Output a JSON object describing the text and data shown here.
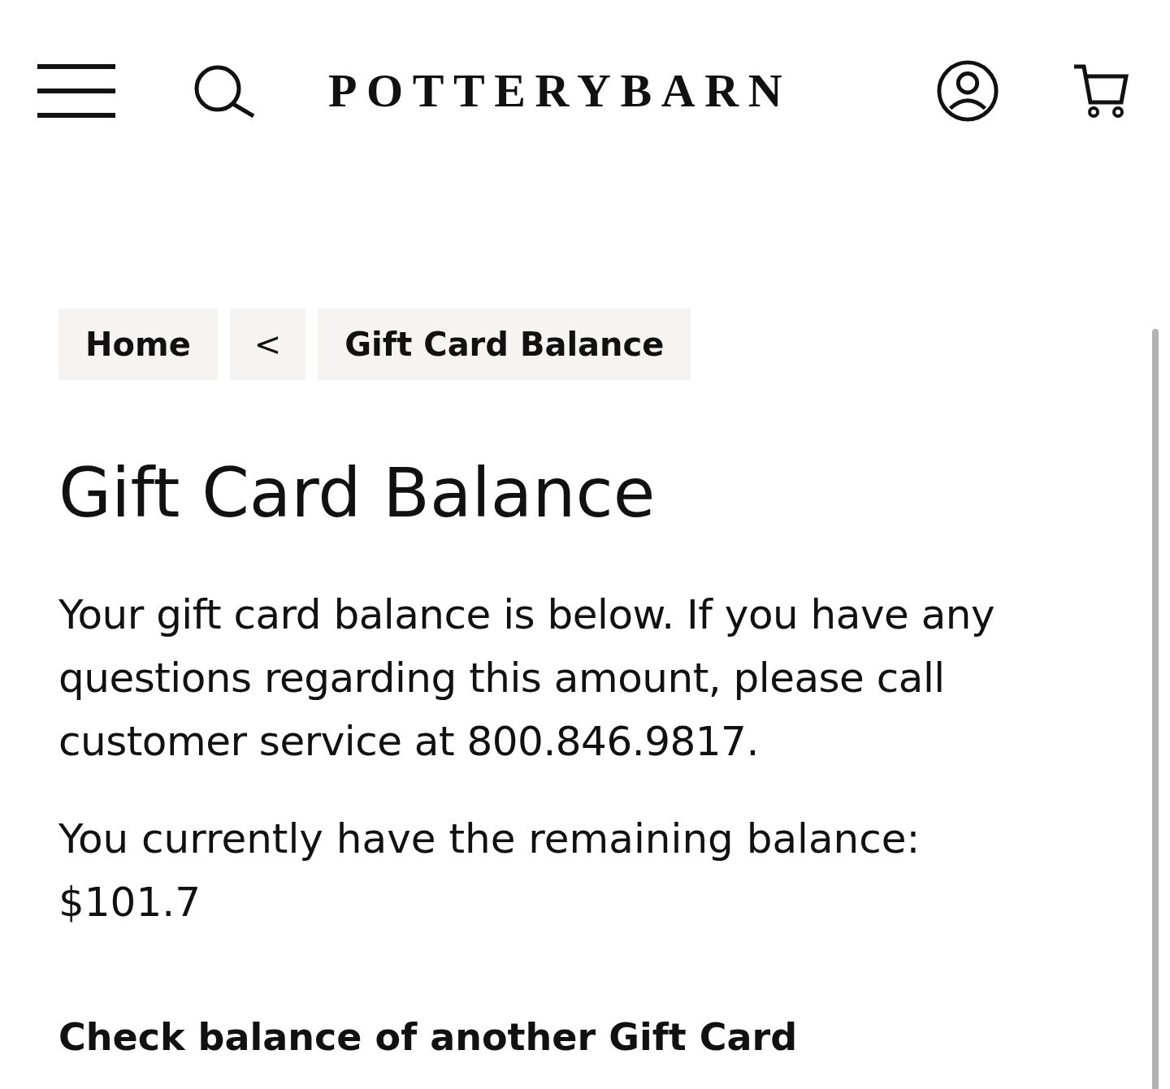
{
  "header": {
    "logo": "POTTERYBARN"
  },
  "breadcrumbs": [
    {
      "label": "Home",
      "kind": "link"
    },
    {
      "label": "<",
      "kind": "separator"
    },
    {
      "label": "Gift Card Balance",
      "kind": "link"
    }
  ],
  "title": "Gift Card Balance",
  "intro": "Your gift card balance is below. If you have any questions regarding this amount, please call customer service at 800.846.9817.",
  "balance_label": "You currently have the remaining balance:",
  "balance": "$101.7",
  "check_another": "Check balance of another Gift Card"
}
